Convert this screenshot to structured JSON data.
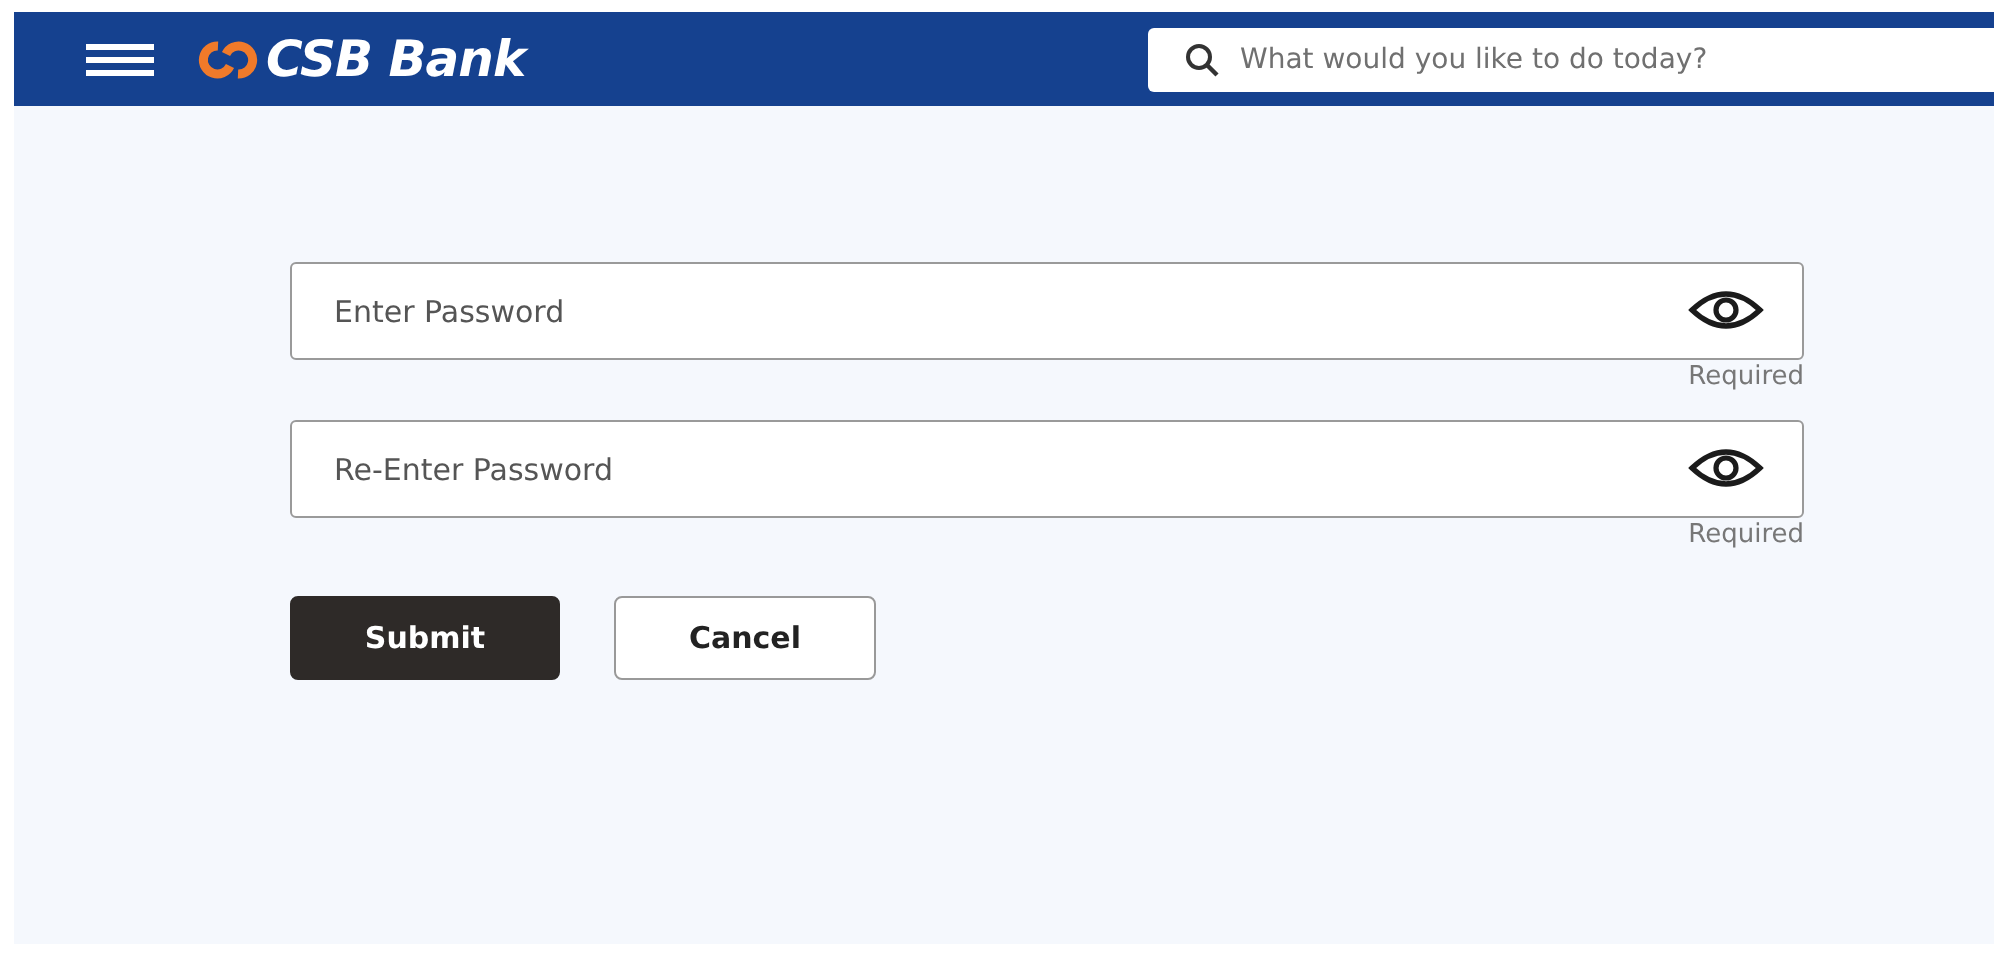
{
  "header": {
    "brand": "CSB Bank",
    "search": {
      "placeholder": "What would you like to do today?"
    }
  },
  "fields": [
    {
      "placeholder": "Enter Password",
      "hint": "Required"
    },
    {
      "placeholder": "Re-Enter Password",
      "hint": "Required"
    }
  ],
  "buttons": [
    {
      "label": "Submit",
      "kind": "primary"
    },
    {
      "label": "Cancel",
      "kind": "secondary"
    }
  ]
}
